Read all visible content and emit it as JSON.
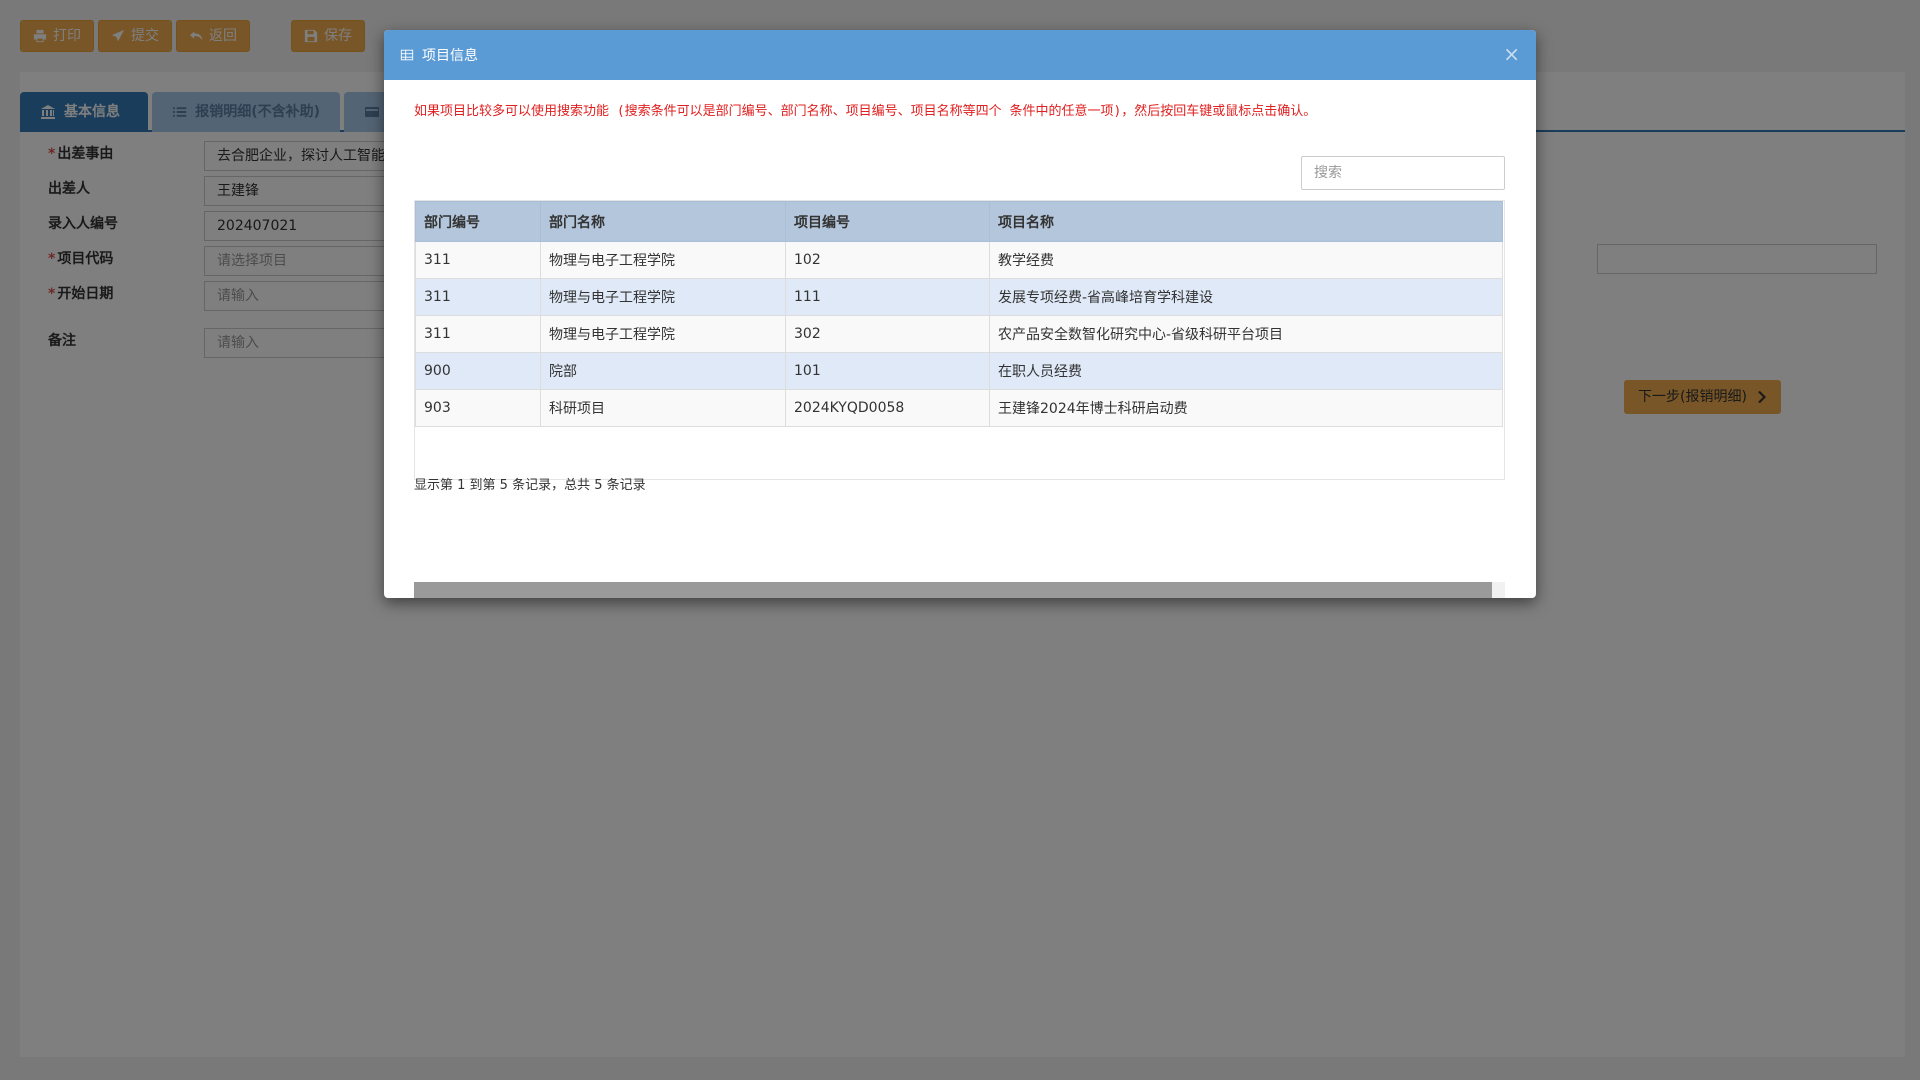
{
  "toolbar": {
    "print_label": "打印",
    "submit_label": "提交",
    "back_label": "返回",
    "save_label": "保存"
  },
  "tabs": [
    {
      "label": "基本信息",
      "icon": "bank-icon"
    },
    {
      "label": "报销明细(不含补助)",
      "icon": "list-icon"
    }
  ],
  "form": {
    "reason_label": "出差事由",
    "reason_value": "去合肥企业，探讨人工智能",
    "traveler_label": "出差人",
    "traveler_value": "王建锋",
    "entry_id_label": "录入人编号",
    "entry_id_value": "202407021",
    "project_code_label": "项目代码",
    "project_code_placeholder": "请选择项目",
    "start_date_label": "开始日期",
    "start_date_placeholder": "请输入",
    "remark_label": "备注",
    "remark_placeholder": "请输入"
  },
  "next_button_label": "下一步(报销明细)",
  "modal": {
    "title": "项目信息",
    "close_glyph": "×",
    "hint": "如果项目比较多可以使用搜索功能 (搜索条件可以是部门编号、部门名称、项目编号、项目名称等四个 条件中的任意一项)，然后按回车键或鼠标点击确认。",
    "search_placeholder": "搜索",
    "columns": [
      "部门编号",
      "部门名称",
      "项目编号",
      "项目名称"
    ],
    "rows": [
      [
        "311",
        "物理与电子工程学院",
        "102",
        "教学经费"
      ],
      [
        "311",
        "物理与电子工程学院",
        "111",
        "发展专项经费-省高峰培育学科建设"
      ],
      [
        "311",
        "物理与电子工程学院",
        "302",
        "农产品安全数智化研究中心-省级科研平台项目"
      ],
      [
        "900",
        "院部",
        "101",
        "在职人员经费"
      ],
      [
        "903",
        "科研项目",
        "2024KYQD0058",
        "王建锋2024年博士科研启动费"
      ]
    ],
    "page_info": "显示第 1 到第 5 条记录，总共 5 条记录"
  },
  "colors": {
    "primary": "#337ab7",
    "modal_header": "#5b9bd5",
    "warning_button": "#f0ad4e",
    "hint_text": "#e02020"
  }
}
